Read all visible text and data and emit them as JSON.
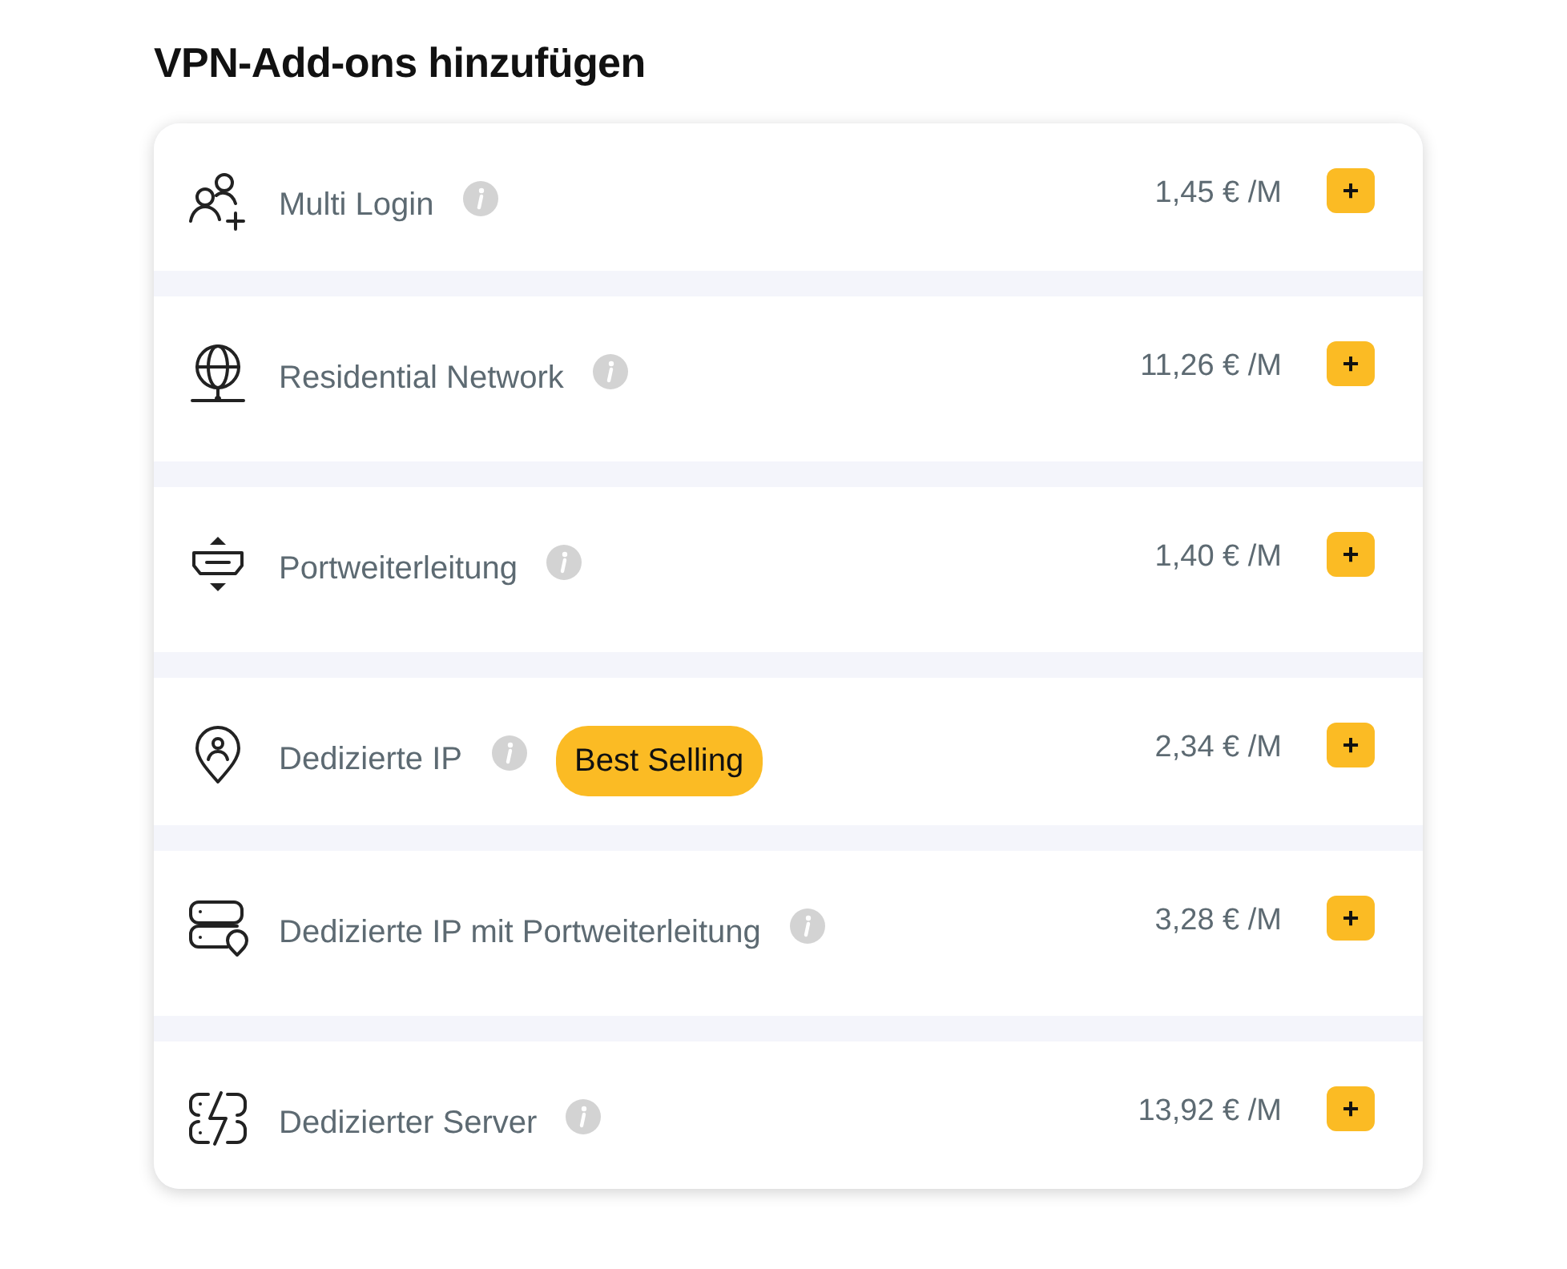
{
  "title": "VPN-Add-ons hinzufügen",
  "addons": [
    {
      "name": "Multi Login",
      "price": "1,45 € /M",
      "add": "+"
    },
    {
      "name": "Residential Network",
      "price": "11,26 € /M",
      "add": "+"
    },
    {
      "name": "Portweiterleitung",
      "price": "1,40 € /M",
      "add": "+"
    },
    {
      "name": "Dedizierte IP",
      "badge": "Best Selling",
      "price": "2,34 € /M",
      "add": "+"
    },
    {
      "name": "Dedizierte IP mit Portweiterleitung",
      "price": "3,28 € /M",
      "add": "+"
    },
    {
      "name": "Dedizierter Server",
      "price": "13,92 € /M",
      "add": "+"
    }
  ]
}
